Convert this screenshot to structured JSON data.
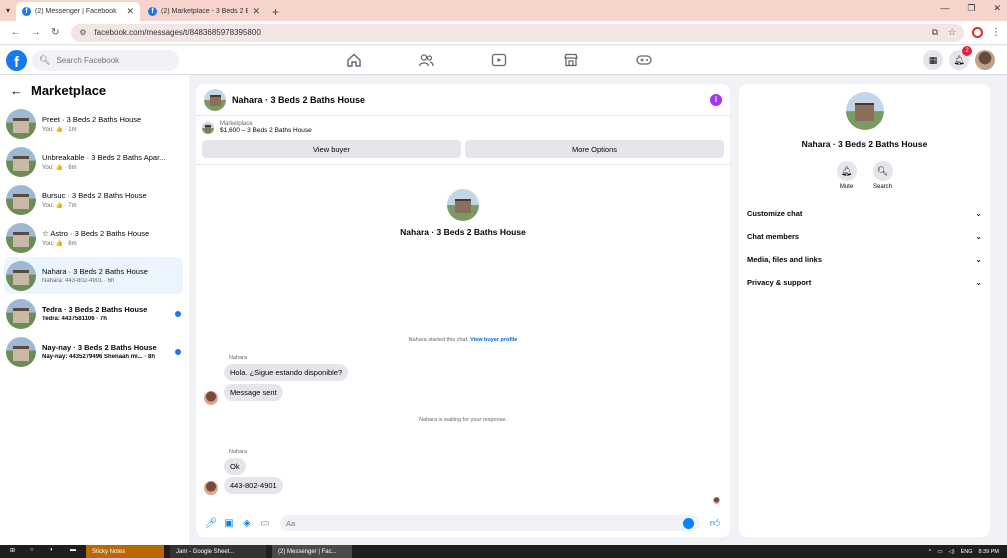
{
  "browser": {
    "tabs": [
      {
        "label": "(2) Messenger | Facebook",
        "active": true
      },
      {
        "label": "(2) Marketplace - 3 Beds 2 Bath",
        "active": false
      }
    ],
    "url": "facebook.com/messages/t/8483685978395800"
  },
  "header": {
    "logo": "f",
    "search_placeholder": "Search Facebook",
    "notifications_count": "2"
  },
  "sidebar": {
    "title": "Marketplace",
    "conversations": [
      {
        "name": "Preet · 3 Beds 2 Baths House",
        "sub": "You: 👍 · 1m",
        "unread": false,
        "active": false
      },
      {
        "name": "Unbreakable · 3 Beds 2 Baths Apar...",
        "sub": "You: 👍 · 6m",
        "unread": false,
        "active": false
      },
      {
        "name": "Bursuc · 3 Beds 2 Baths House",
        "sub": "You: 👍 · 7m",
        "unread": false,
        "active": false
      },
      {
        "name": "☆ Astro · 3 Beds 2 Baths House",
        "sub": "You: 👍 · 8m",
        "unread": false,
        "active": false
      },
      {
        "name": "Nahara · 3 Beds 2 Baths House",
        "sub": "Nahara: 443-802-4901 · 6h",
        "unread": false,
        "active": true
      },
      {
        "name": "Tedra · 3 Beds 2 Baths House",
        "sub": "Tedra: 4437581106 · 7h",
        "unread": true,
        "active": false
      },
      {
        "name": "Nay-nay · 3 Beds 2 Baths House",
        "sub": "Nay-nay: 4435279496 Shenaah mi... · 8h",
        "unread": true,
        "active": false
      }
    ]
  },
  "chat": {
    "title": "Nahara · 3 Beds 2 Baths House",
    "marketplace_label": "Marketplace",
    "listing": "$1,600 – 3 Beds 2 Baths House",
    "view_buyer": "View buyer",
    "more_options": "More Options",
    "profile_name": "Nahara · 3 Beds 2 Baths House",
    "started_text": "Nahara started this chat.",
    "view_profile_link": "View buyer profile",
    "sender_1": "Nahara",
    "msg_1": "Hola. ¿Sigue estando disponible?",
    "msg_2": "Message sent",
    "waiting_text": "Nahara is waiting for your response.",
    "sender_2": "Nahara",
    "msg_3": "Ok",
    "msg_4": "443-802-4901",
    "composer_placeholder": "Aa"
  },
  "details": {
    "name": "Nahara · 3 Beds 2 Baths House",
    "mute_label": "Mute",
    "search_label": "Search",
    "sections": [
      "Customize chat",
      "Chat members",
      "Media, files and links",
      "Privacy & support"
    ]
  },
  "taskbar": {
    "apps": [
      "Sticky Notes",
      "Jam - Google Sheet...",
      "(2) Messenger | Fac..."
    ],
    "lang": "ENG",
    "time": "8:39 PM"
  }
}
